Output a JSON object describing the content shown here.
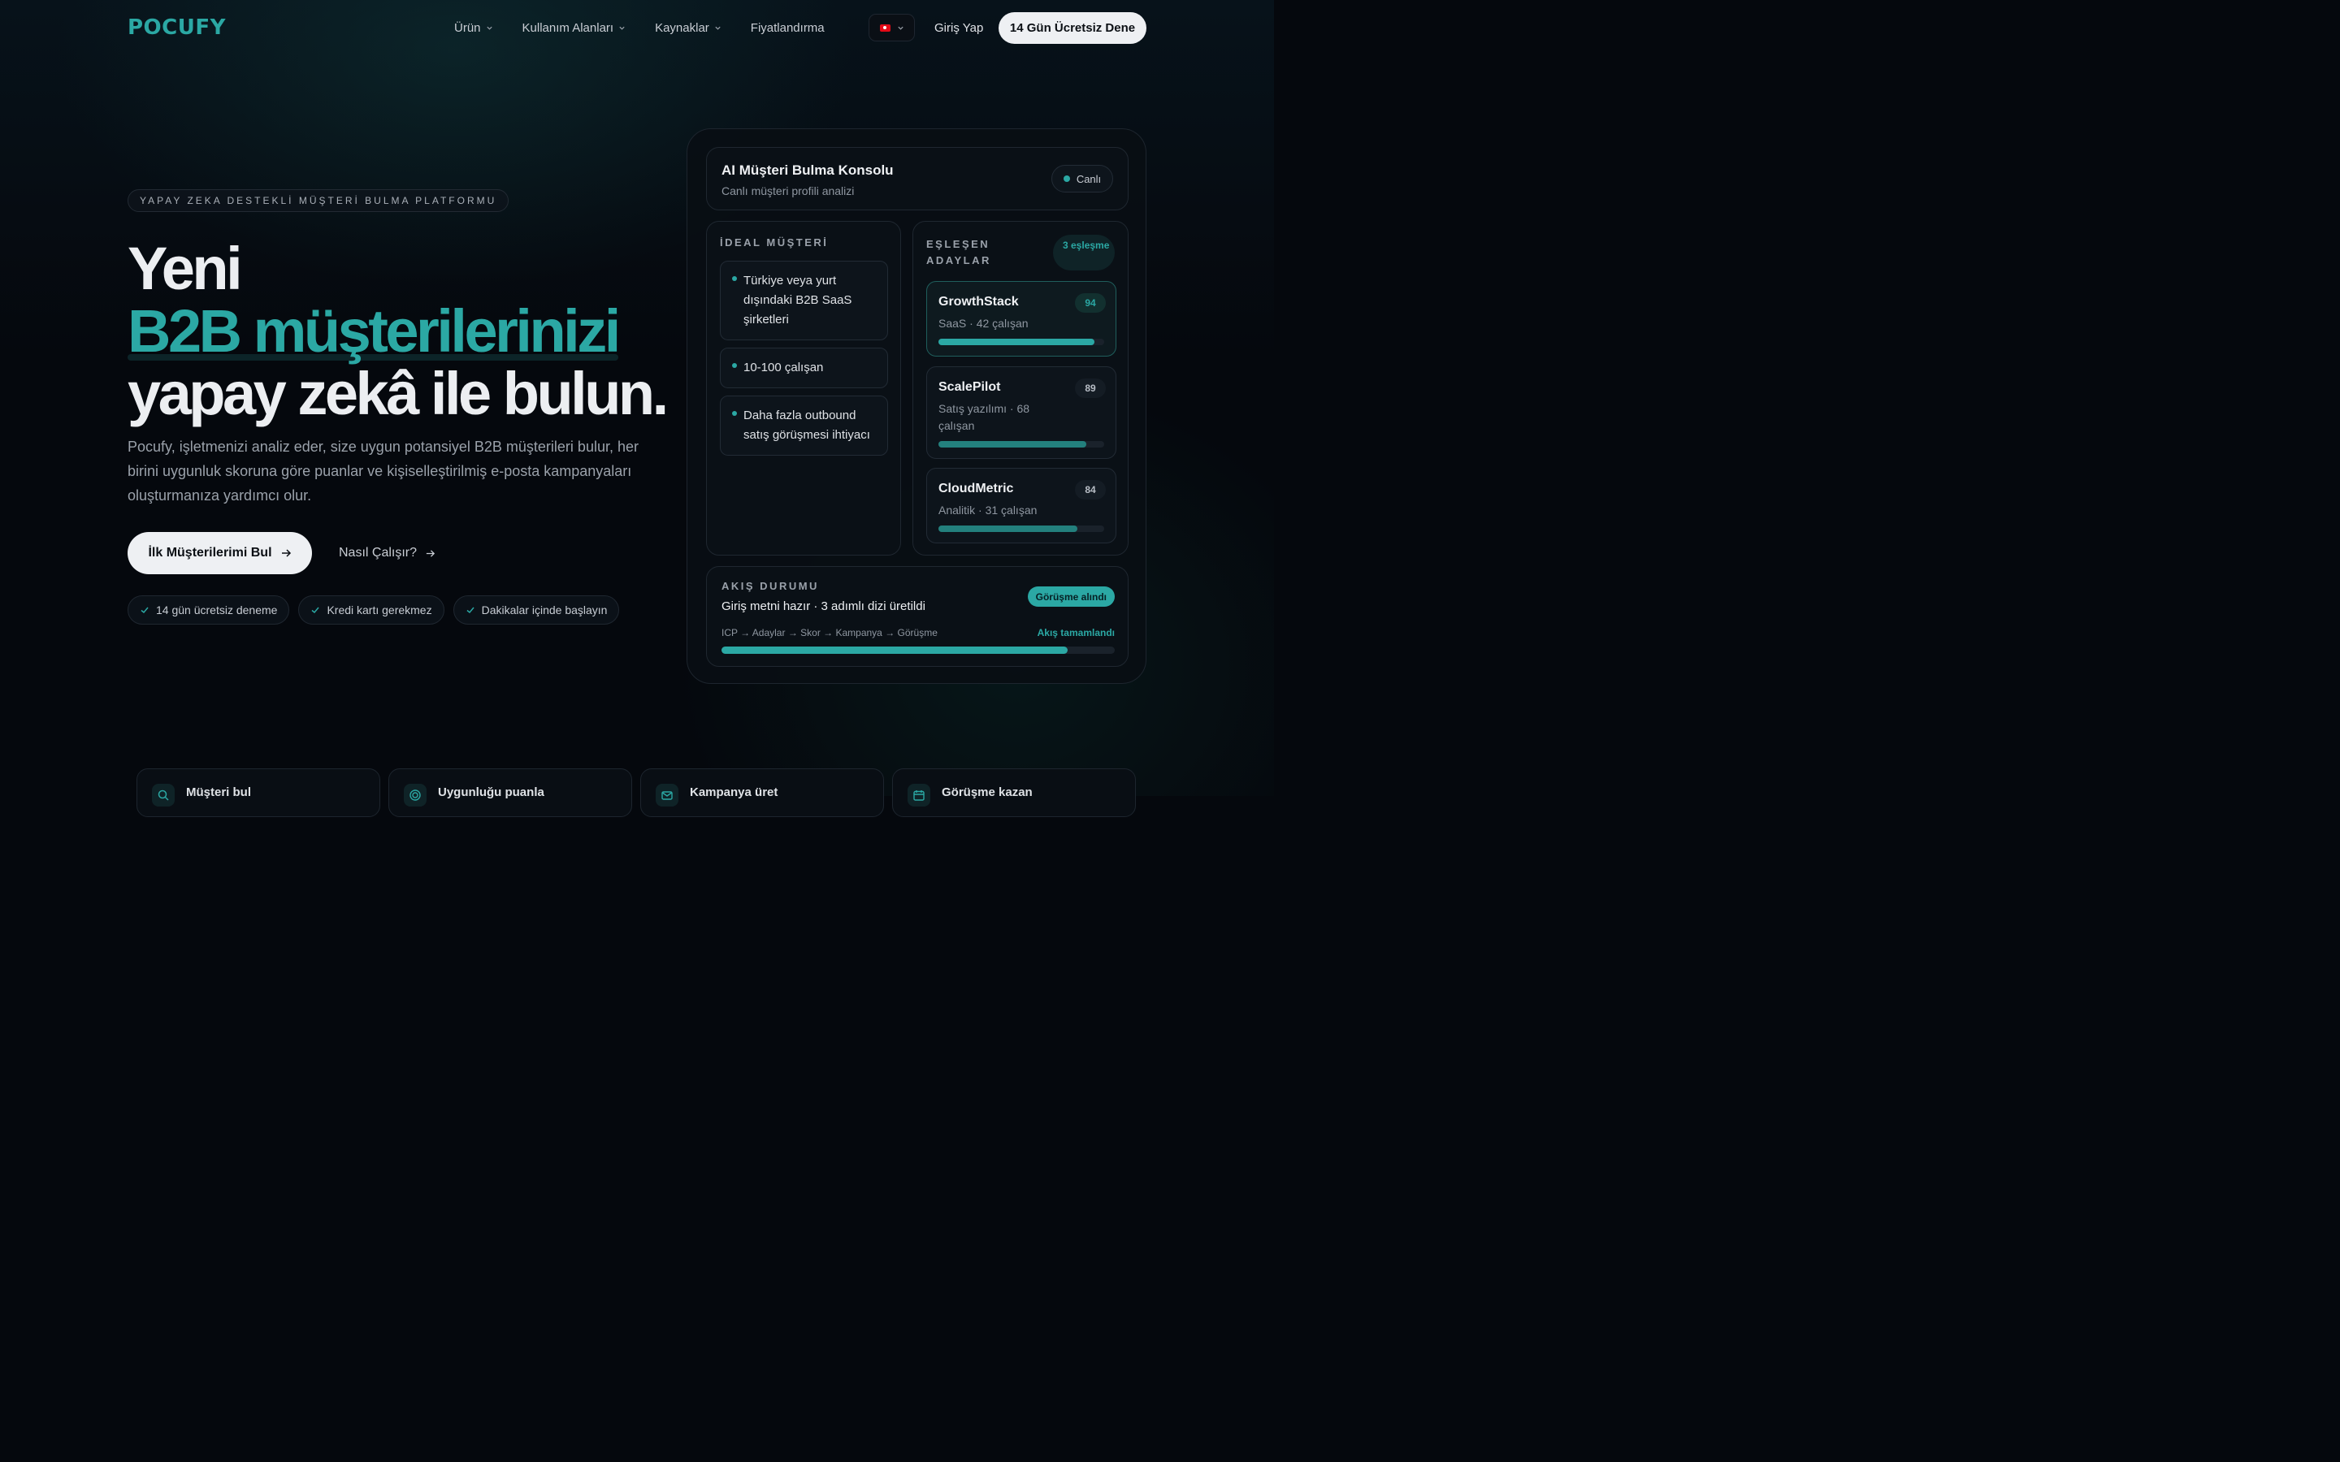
{
  "brand": {
    "logo": "POCUFY",
    "accent": "#2ba8a4"
  },
  "nav": {
    "items": [
      {
        "label": "Ürün",
        "dropdown": true
      },
      {
        "label": "Kullanım Alanları",
        "dropdown": true
      },
      {
        "label": "Kaynaklar",
        "dropdown": true
      },
      {
        "label": "Fiyatlandırma",
        "dropdown": false
      }
    ],
    "language": "tr-flag-icon",
    "login": "Giriş Yap",
    "trial": "14 Gün Ücretsiz Dene"
  },
  "hero": {
    "eyebrow": "YAPAY ZEKA DESTEKLİ MÜŞTERİ BULMA PLATFORMU",
    "title_line1": "Yeni",
    "title_line2": "B2B müşterilerinizi",
    "title_line3": "yapay zekâ ile bulun.",
    "lead": "Pocufy, işletmenizi analiz eder, size uygun potansiyel B2B müşterileri bulur, her birini uygunluk skoruna göre puanlar ve kişiselleştirilmiş e-posta kampanyaları oluşturmanıza yardımcı olur.",
    "primary_cta": "İlk Müşterilerimi Bul",
    "secondary_cta": "Nasıl Çalışır?",
    "chips": [
      "14 gün ücretsiz deneme",
      "Kredi kartı gerekmez",
      "Dakikalar içinde başlayın"
    ]
  },
  "console": {
    "title": "AI Müşteri Bulma Konsolu",
    "subtitle": "Canlı müşteri profili analizi",
    "live": "Canlı",
    "ideal": {
      "title": "İDEAL MÜŞTERİ",
      "items": [
        "Türkiye veya yurt dışındaki B2B SaaS şirketleri",
        "10-100 çalışan",
        "Daha fazla outbound satış görüşmesi ihtiyacı"
      ]
    },
    "matches": {
      "title": "EŞLEŞEN ADAYLAR",
      "badge": "3 eşleşme",
      "leads": [
        {
          "name": "GrowthStack",
          "meta": "SaaS · 42 çalışan",
          "score": "94",
          "fill": 0.94
        },
        {
          "name": "ScalePilot",
          "meta": "Satış yazılımı · 68 çalışan",
          "score": "89",
          "fill": 0.89
        },
        {
          "name": "CloudMetric",
          "meta": "Analitik · 31 çalışan",
          "score": "84",
          "fill": 0.84
        }
      ]
    },
    "flow": {
      "title": "AKIŞ DURUMU",
      "text": "Giriş metni hazır · 3 adımlı dizi üretildi",
      "badge": "Görüşme alındı",
      "steps": "ICP → Adaylar → Skor → Kampanya → Görüşme",
      "done": "Akış tamamlandı",
      "progress": 0.88
    }
  },
  "features": [
    {
      "label": "Müşteri bul",
      "icon": "search-icon"
    },
    {
      "label": "Uygunluğu puanla",
      "icon": "target-icon"
    },
    {
      "label": "Kampanya üret",
      "icon": "mail-icon"
    },
    {
      "label": "Görüşme kazan",
      "icon": "calendar-icon"
    }
  ]
}
